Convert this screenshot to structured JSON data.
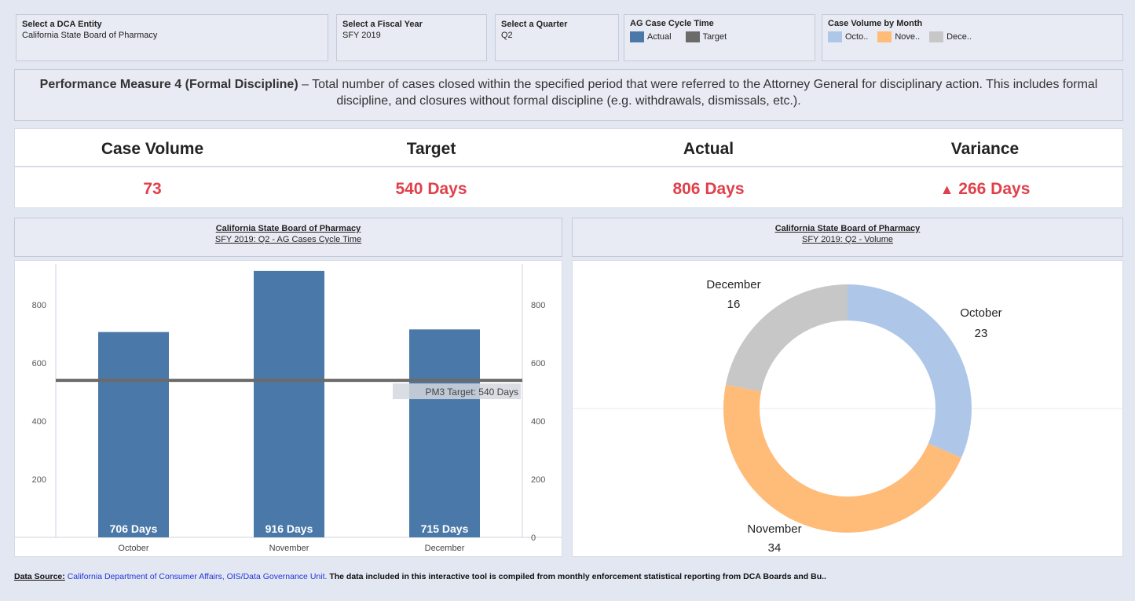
{
  "filters": {
    "entity": {
      "label": "Select a DCA Entity",
      "value": "California State Board of Pharmacy"
    },
    "fiscal_year": {
      "label": "Select a Fiscal Year",
      "value": "SFY 2019"
    },
    "quarter": {
      "label": "Select a Quarter",
      "value": "Q2"
    },
    "cycle_legend": {
      "label": "AG Case Cycle Time",
      "actual": "Actual",
      "target": "Target",
      "actual_color": "#4a78a8",
      "target_color": "#6d6a6a"
    },
    "volume_legend": {
      "label": "Case Volume by Month",
      "items": [
        "Octo..",
        "Nove..",
        "Dece.."
      ],
      "colors": [
        "#aec6e8",
        "#ffbb78",
        "#c7c7c7"
      ]
    }
  },
  "description": {
    "bold": "Performance Measure 4 (Formal Discipline)",
    "text": " – Total number of cases closed within the specified period that were referred to the Attorney General for disciplinary action. This includes formal discipline, and closures without formal discipline (e.g. withdrawals, dismissals, etc.)."
  },
  "kpis": {
    "case_volume": {
      "label": "Case Volume",
      "value": "73"
    },
    "target": {
      "label": "Target",
      "value": "540 Days"
    },
    "actual": {
      "label": "Actual",
      "value": "806 Days"
    },
    "variance": {
      "label": "Variance",
      "arrow": "▲",
      "value": "266 Days"
    }
  },
  "bar_panel": {
    "title": "California State Board of Pharmacy",
    "subtitle": "SFY 2019: Q2 - AG Cases Cycle Time"
  },
  "pie_panel": {
    "title": "California State Board of Pharmacy",
    "subtitle": "SFY 2019: Q2 - Volume"
  },
  "footer": {
    "source_label": "Data Source:",
    "source_link": "California Department of Consumer Affairs, OIS/Data Governance Unit.",
    "text": "The data included in this interactive tool is compiled from monthly enforcement statistical reporting from DCA Boards and Bu.."
  },
  "chart_data": [
    {
      "type": "bar",
      "categories": [
        "October",
        "November",
        "December"
      ],
      "values": [
        706,
        916,
        715
      ],
      "data_labels": [
        "706 Days",
        "916 Days",
        "715 Days"
      ],
      "color": "#4a78a8",
      "reference_line": {
        "value": 540,
        "label": "PM3 Target: 540 Days",
        "color": "#6d6a6a"
      },
      "yticks_left": [
        "200",
        "400",
        "600",
        "800"
      ],
      "yticks_right": [
        "0",
        "200",
        "400",
        "600",
        "800"
      ],
      "ylim": [
        0,
        940
      ],
      "grid": false
    },
    {
      "type": "pie",
      "variant": "donut",
      "labels": [
        "October",
        "November",
        "December"
      ],
      "values": [
        23,
        34,
        16
      ],
      "colors": [
        "#aec6e8",
        "#ffbb78",
        "#c7c7c7"
      ]
    }
  ]
}
